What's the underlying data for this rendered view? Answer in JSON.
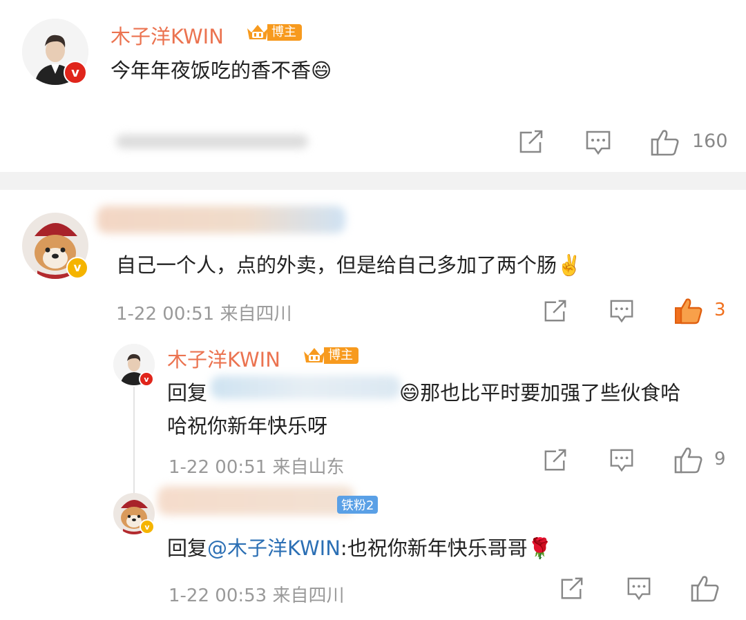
{
  "post": {
    "author_name": "木子洋KWIN",
    "badge_label": "博主",
    "text": "今年年夜饭吃的香不香",
    "text_emoji": "😄",
    "like_count": "160"
  },
  "comment1": {
    "text": "自己一个人，点的外卖，但是给自己多加了两个肠",
    "text_emoji": "✌️",
    "time": "1-22 00:51",
    "location": "来自四川",
    "like_count": "3"
  },
  "reply1": {
    "author_name": "木子洋KWIN",
    "badge_label": "博主",
    "reply_prefix": "回复",
    "text_line1": "那也比平时要加强了些伙食哈",
    "text_line2": "哈祝你新年快乐呀",
    "time": "1-22 00:51",
    "location": "来自山东",
    "like_count": "9"
  },
  "reply2": {
    "fan_badge": "铁粉2",
    "reply_prefix": "回复",
    "mention": "@木子洋KWIN",
    "text": ":也祝你新年快乐哥哥",
    "text_emoji": "🌹",
    "time": "1-22 00:53",
    "location": "来自四川"
  },
  "colors": {
    "name": "#eb7350",
    "mention": "#2b6fb4",
    "like_active": "#f0701e",
    "badge_orange": "#f79a1e",
    "fan_badge_blue": "#5aa0e6",
    "verified_red": "#e0251b",
    "verified_gold": "#f5b400"
  },
  "icons": {
    "share": "share-icon",
    "comment": "comment-icon",
    "like": "thumbs-up-icon"
  }
}
